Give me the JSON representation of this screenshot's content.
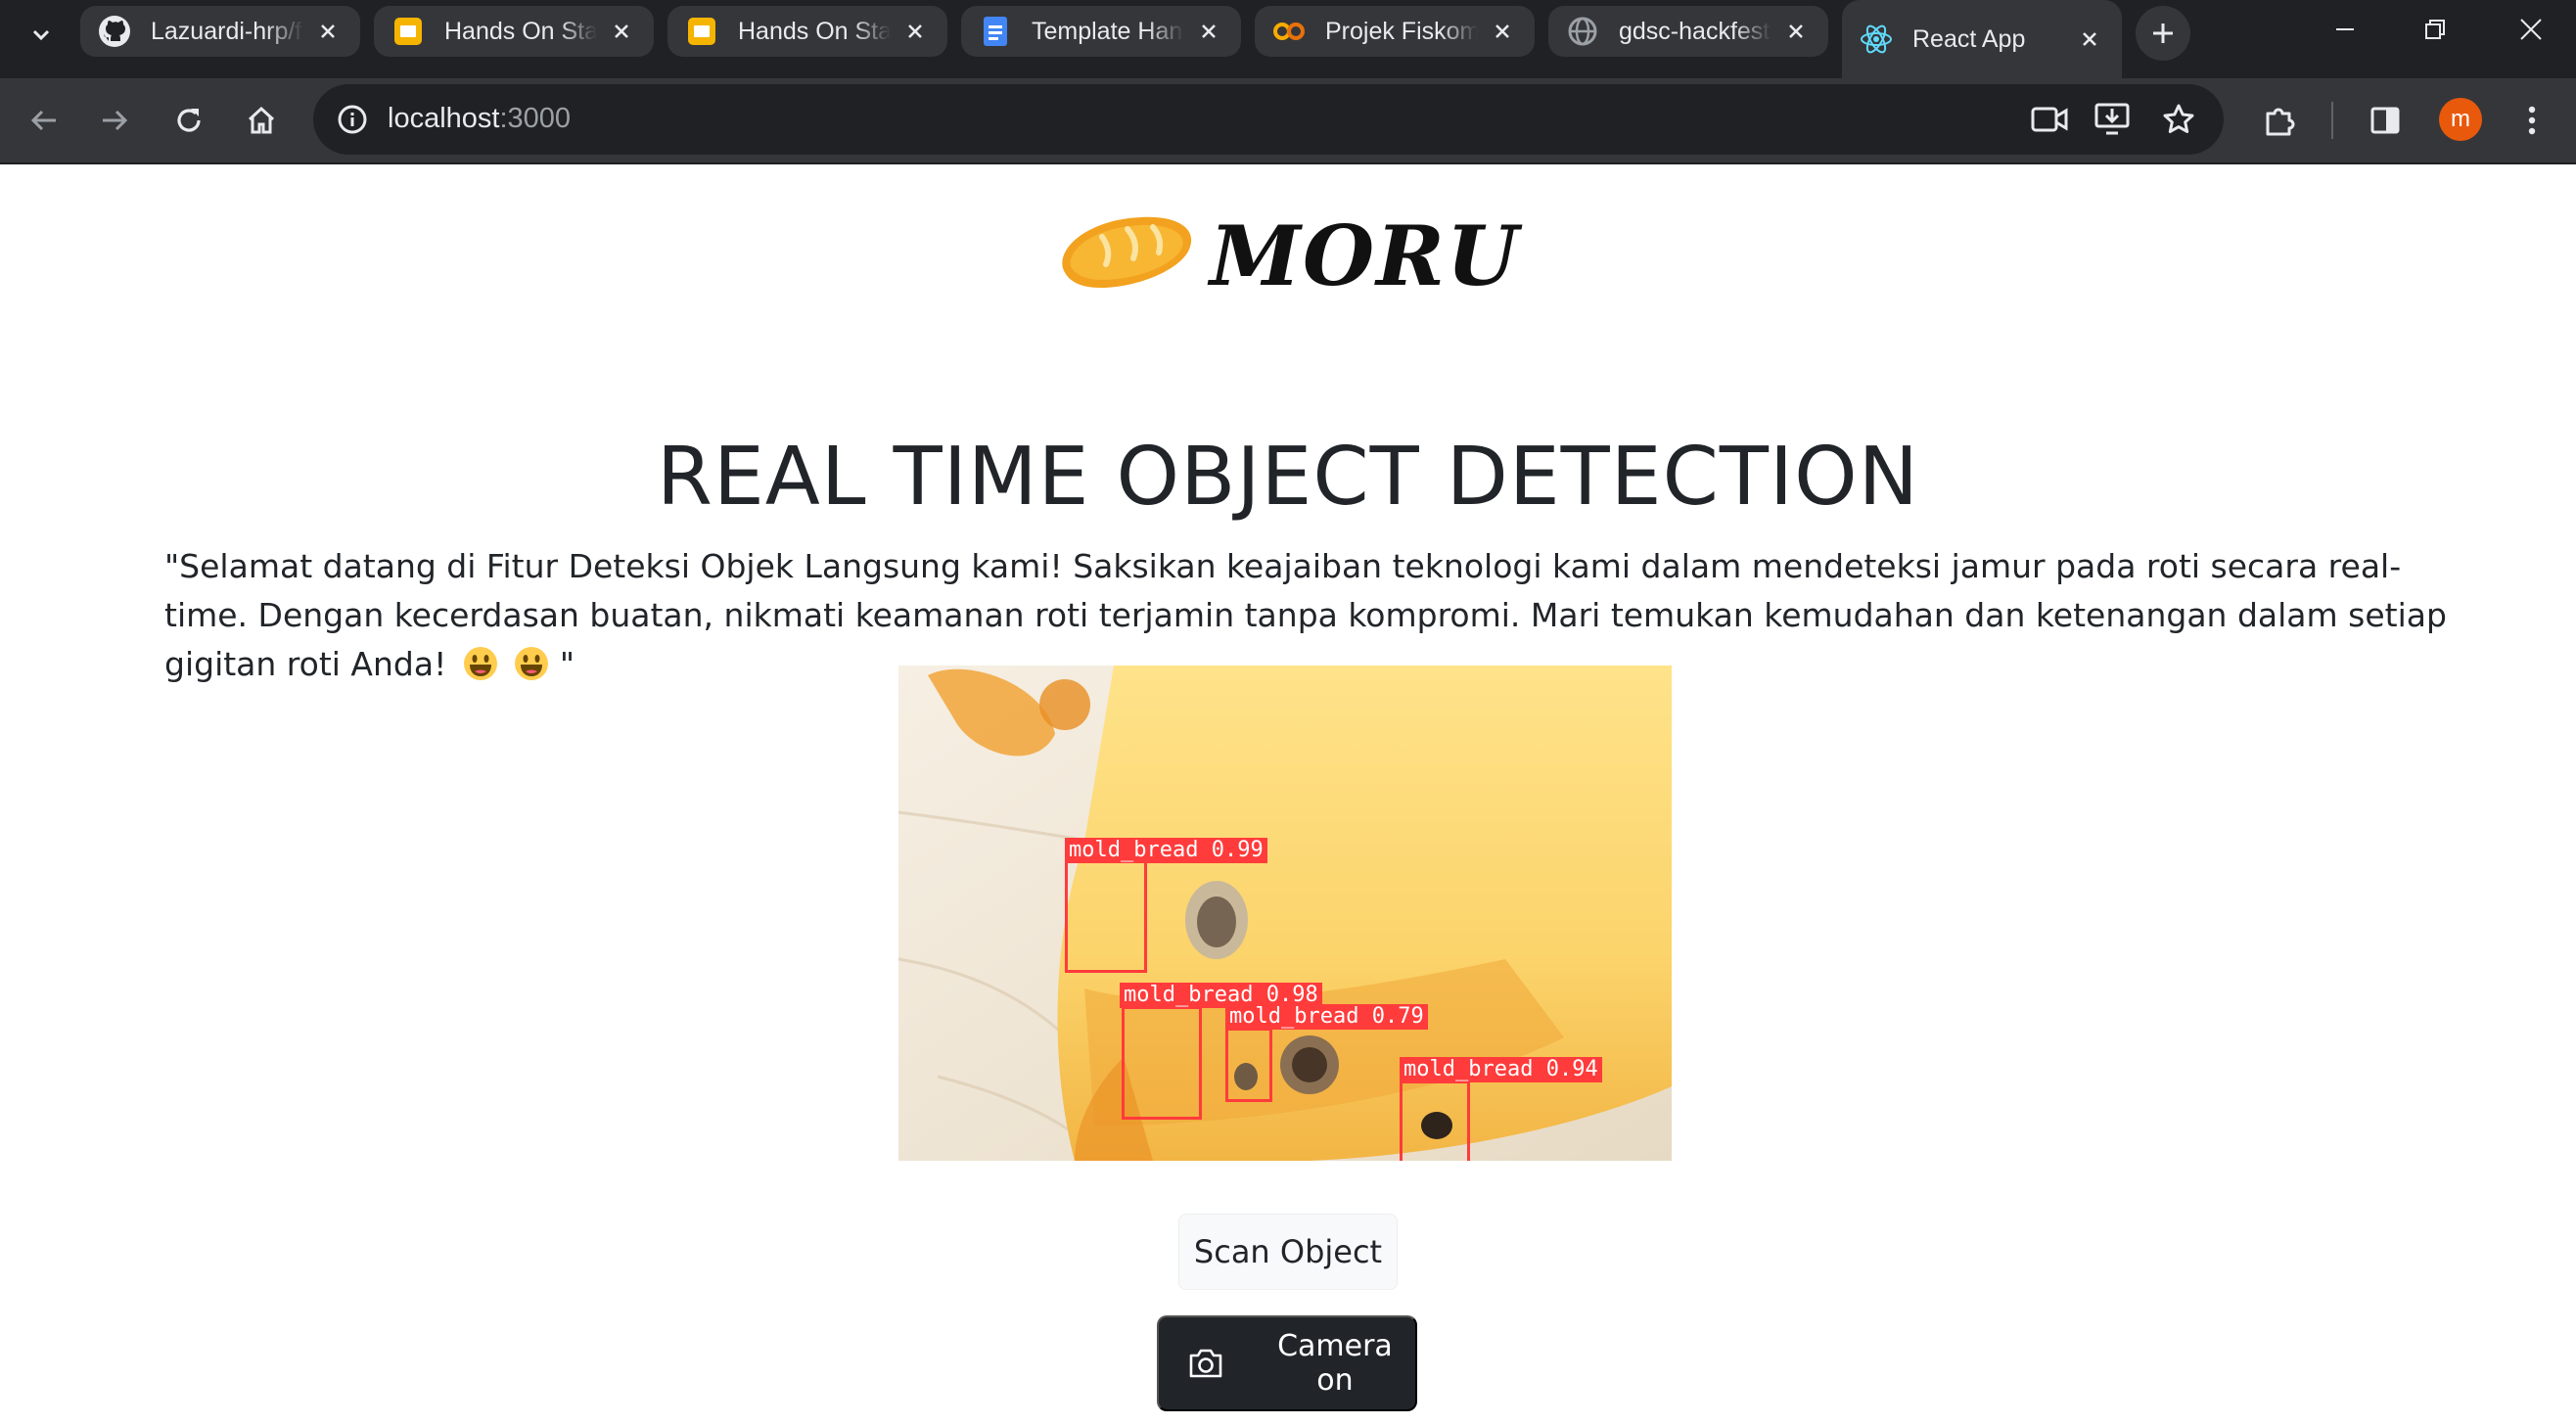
{
  "browser": {
    "tabs": [
      {
        "title": "Lazuardi-hrp/f",
        "icon": "github-icon",
        "active": false
      },
      {
        "title": "Hands On Stage",
        "icon": "slides-icon",
        "active": false
      },
      {
        "title": "Hands On Stage",
        "icon": "slides-icon",
        "active": false
      },
      {
        "title": "Template Hands",
        "icon": "docs-icon",
        "active": false
      },
      {
        "title": "Projek Fiskom",
        "icon": "colab-icon",
        "active": false
      },
      {
        "title": "gdsc-hackfest",
        "icon": "globe-icon",
        "active": false
      },
      {
        "title": "React App",
        "icon": "react-icon",
        "active": true
      }
    ],
    "url_host": "localhost",
    "url_port": ":3000",
    "profile_initial": "m"
  },
  "page": {
    "logo_text": "MORU",
    "title": "REAL TIME OBJECT DETECTION",
    "description": "\"Selamat datang di Fitur Deteksi Objek Langsung kami! Saksikan keajaiban teknologi kami dalam mendeteksi jamur pada roti secara real-time. Dengan kecerdasan buatan, nikmati keamanan roti terjamin tanpa kompromi. Mari temukan kemudahan dan ketenangan dalam setiap gigitan roti Anda!",
    "description_end": "\"",
    "detections": [
      {
        "label": "mold_bread",
        "score": "0.99"
      },
      {
        "label": "mold_bread",
        "score": "0.98"
      },
      {
        "label": "mold_bread",
        "score": "0.79"
      },
      {
        "label": "mold_bread",
        "score": "0.94"
      }
    ],
    "scan_button": "Scan Object",
    "camera_button": "Camera on"
  },
  "colors": {
    "detection_box": "#ff3b3b",
    "chrome_dark": "#202124",
    "chrome_toolbar": "#35363a",
    "camera_button_bg": "#212529"
  }
}
